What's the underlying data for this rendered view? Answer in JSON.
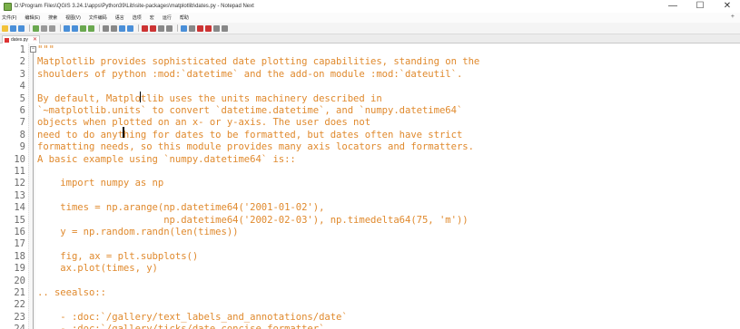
{
  "window": {
    "title": "D:\\Program Files\\QGIS 3.24.1\\apps\\Python39\\Lib\\site-packages\\matplotlib\\dates.py - Notepad Next",
    "minimize": "—",
    "maximize": "☐",
    "close": "✕"
  },
  "menu": {
    "items": [
      "文件(F)",
      "编辑(E)",
      "搜索",
      "视图(V)",
      "文件编码",
      "语言",
      "选项",
      "宏",
      "运行",
      "帮助"
    ],
    "overflow": "+"
  },
  "toolbar": {
    "colors": [
      "#f2c23a",
      "#4a8fd8",
      "#4a8fd8",
      "#6aa84f",
      "#999999",
      "#999999",
      "#4a8fd8",
      "#4a8fd8",
      "#6aa84f",
      "#6aa84f",
      "#888888",
      "#888888",
      "#4a8fd8",
      "#4a8fd8",
      "#cc3333",
      "#cc3333",
      "#888888",
      "#888888",
      "#4a8fd8",
      "#888888",
      "#cc3333",
      "#cc3333",
      "#888888",
      "#888888"
    ]
  },
  "tab": {
    "label": "dates.py",
    "close": "✕"
  },
  "editor": {
    "lines": [
      {
        "num": "1",
        "text": "\"\"\""
      },
      {
        "num": "2",
        "text": "Matplotlib provides sophisticated date plotting capabilities, standing on the"
      },
      {
        "num": "3",
        "text": "shoulders of python :mod:`datetime` and the add-on module :mod:`dateutil`."
      },
      {
        "num": "4",
        "text": ""
      },
      {
        "num": "5",
        "text": "By default, Matplotlib uses the units machinery described in"
      },
      {
        "num": "6",
        "text": "`~matplotlib.units` to convert `datetime.datetime`, and `numpy.datetime64`"
      },
      {
        "num": "7",
        "text": "objects when plotted on an x- or y-axis. The user does not"
      },
      {
        "num": "8",
        "text": "need to do anything for dates to be formatted, but dates often have strict"
      },
      {
        "num": "9",
        "text": "formatting needs, so this module provides many axis locators and formatters."
      },
      {
        "num": "10",
        "text": "A basic example using `numpy.datetime64` is::"
      },
      {
        "num": "11",
        "text": ""
      },
      {
        "num": "12",
        "text": "    import numpy as np"
      },
      {
        "num": "13",
        "text": ""
      },
      {
        "num": "14",
        "text": "    times = np.arange(np.datetime64('2001-01-02'),"
      },
      {
        "num": "15",
        "text": "                      np.datetime64('2002-02-03'), np.timedelta64(75, 'm'))"
      },
      {
        "num": "16",
        "text": "    y = np.random.randn(len(times))"
      },
      {
        "num": "17",
        "text": ""
      },
      {
        "num": "18",
        "text": "    fig, ax = plt.subplots()"
      },
      {
        "num": "19",
        "text": "    ax.plot(times, y)"
      },
      {
        "num": "20",
        "text": ""
      },
      {
        "num": "21",
        "text": ".. seealso::"
      },
      {
        "num": "22",
        "text": ""
      },
      {
        "num": "23",
        "text": "    - :doc:`/gallery/text_labels_and_annotations/date`"
      },
      {
        "num": "24",
        "text": "    - :doc:`/gallery/ticks/date_concise_formatter`"
      }
    ],
    "text_color": "#e08a2e",
    "line_number_color": "#6b6b6b"
  }
}
